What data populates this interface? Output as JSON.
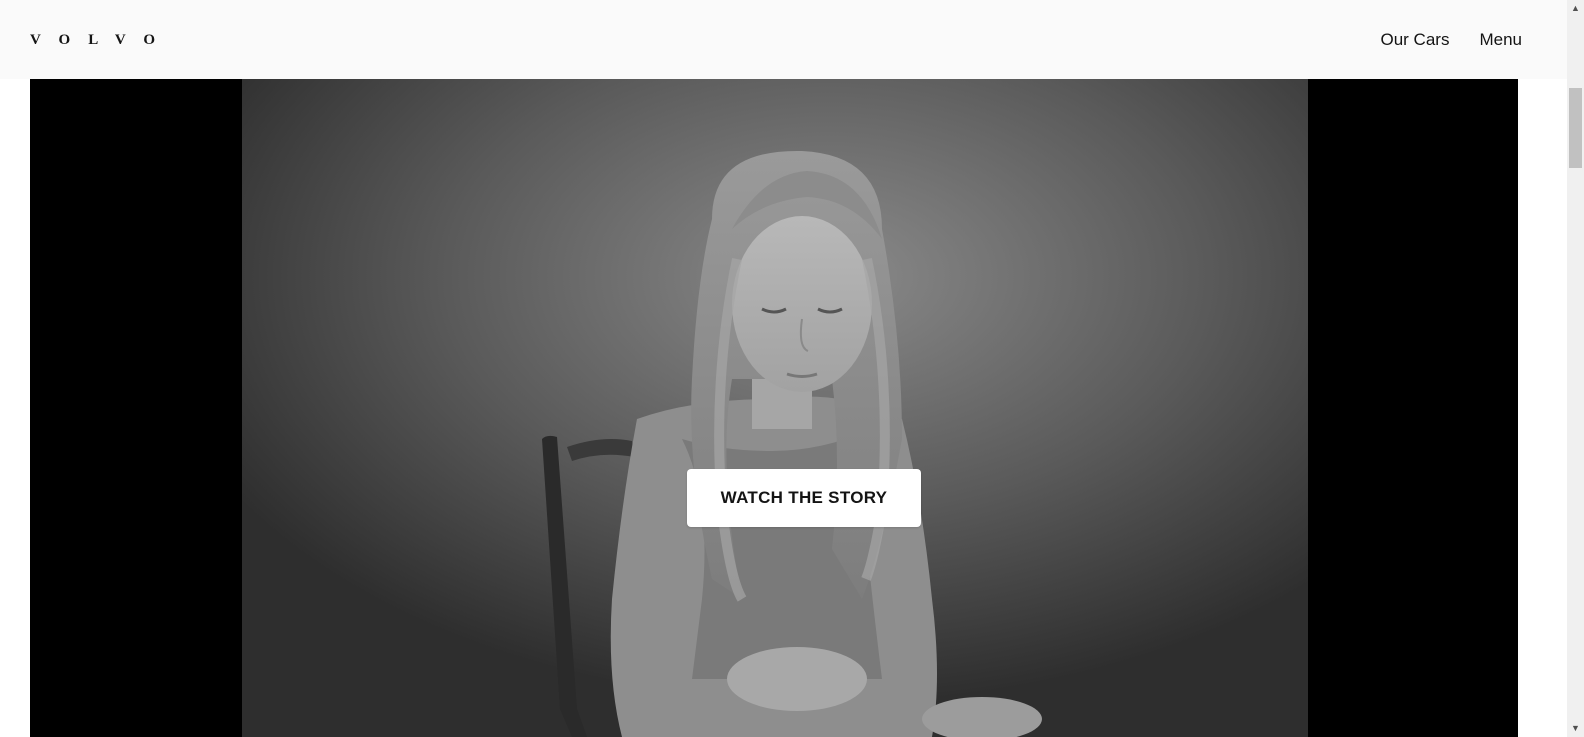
{
  "header": {
    "logo_text": "VOLVO",
    "nav": {
      "our_cars": "Our Cars",
      "menu": "Menu"
    }
  },
  "hero": {
    "image_description_icon": "video-still-image",
    "cta_label": "WATCH THE STORY"
  },
  "colors": {
    "header_bg": "#fafafa",
    "text": "#141414",
    "hero_bg": "#000000",
    "cta_bg": "#ffffff"
  },
  "scrollbar": {
    "up_icon": "triangle-up-icon",
    "down_icon": "triangle-down-icon"
  }
}
